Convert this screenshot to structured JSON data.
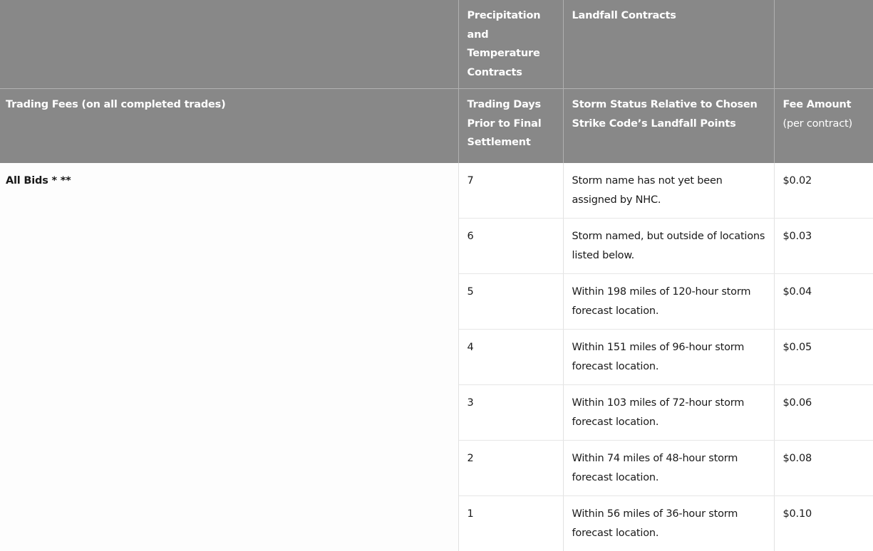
{
  "header": {
    "top_row": {
      "col1": "",
      "col2": "Precipitation and Temperature Contracts",
      "col3": "Landfall Contracts",
      "col4": ""
    },
    "bottom_row": {
      "col1": "Trading Fees (on all completed trades)",
      "col2": "Trading Days Prior to Final Settlement",
      "col3": "Storm Status Relative to Chosen Strike Code’s Landfall Points",
      "col4_bold": "Fee Amount",
      "col4_note": "(per contract)"
    }
  },
  "label": "All Bids *  **",
  "rows": [
    {
      "days": "7",
      "status": "Storm name has not yet been assigned by NHC.",
      "fee": "$0.02"
    },
    {
      "days": "6",
      "status": "Storm named, but outside of locations listed below.",
      "fee": "$0.03"
    },
    {
      "days": "5",
      "status": "Within 198 miles of 120-hour storm forecast location.",
      "fee": "$0.04"
    },
    {
      "days": "4",
      "status": "Within 151 miles of 96-hour storm forecast location.",
      "fee": "$0.05"
    },
    {
      "days": "3",
      "status": "Within 103 miles of 72-hour storm forecast location.",
      "fee": "$0.06"
    },
    {
      "days": "2",
      "status": "Within 74 miles of 48-hour storm forecast location.",
      "fee": "$0.08"
    },
    {
      "days": "1",
      "status": "Within 56 miles of 36-hour storm forecast location.",
      "fee": "$0.10"
    }
  ]
}
